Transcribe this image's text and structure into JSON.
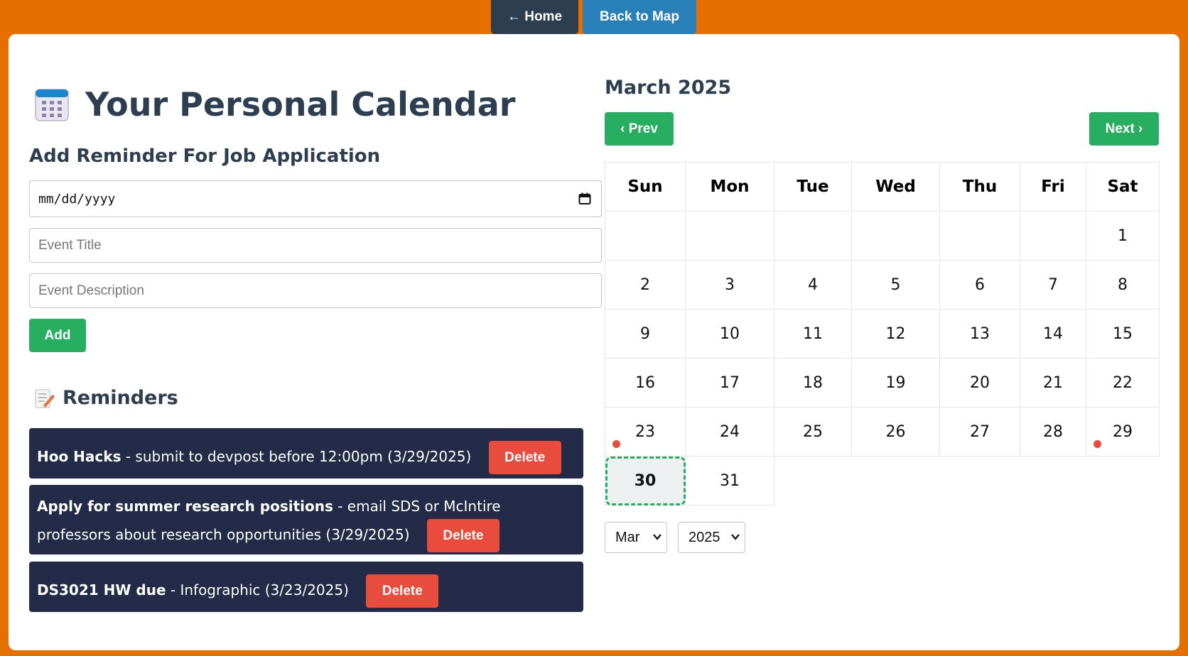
{
  "nav": {
    "home_label": "← Home",
    "map_label": "Back to Map"
  },
  "page": {
    "title": "Your Personal Calendar",
    "subtitle": "Add Reminder For Job Application"
  },
  "form": {
    "date_placeholder": "mm/dd/yyyy",
    "title_placeholder": "Event Title",
    "description_placeholder": "Event Description",
    "add_label": "Add"
  },
  "reminders": {
    "heading": "Reminders",
    "delete_label": "Delete",
    "items": [
      {
        "title": "Hoo Hacks",
        "text": " - submit to devpost before 12:00pm (3/29/2025)"
      },
      {
        "title": "Apply for summer research positions",
        "text": " - email SDS or McIntire professors about research opportunities (3/29/2025)"
      },
      {
        "title": "DS3021 HW due",
        "text": " - Infographic (3/23/2025)"
      }
    ]
  },
  "calendar": {
    "month_title": "March 2025",
    "prev_label": "‹ Prev",
    "next_label": "Next ›",
    "weekdays": [
      "Sun",
      "Mon",
      "Tue",
      "Wed",
      "Thu",
      "Fri",
      "Sat"
    ],
    "weeks": [
      [
        "",
        "",
        "",
        "",
        "",
        "",
        "1"
      ],
      [
        "2",
        "3",
        "4",
        "5",
        "6",
        "7",
        "8"
      ],
      [
        "9",
        "10",
        "11",
        "12",
        "13",
        "14",
        "15"
      ],
      [
        "16",
        "17",
        "18",
        "19",
        "20",
        "21",
        "22"
      ],
      [
        "23",
        "24",
        "25",
        "26",
        "27",
        "28",
        "29"
      ],
      [
        "30",
        "31"
      ]
    ],
    "event_days": [
      "23",
      "29"
    ],
    "today": "30",
    "month_select": "Mar",
    "year_select": "2025"
  },
  "colors": {
    "background": "#e57000",
    "accent_green": "#27ae60",
    "delete_red": "#e74c3c",
    "reminder_bg": "#232b48"
  }
}
